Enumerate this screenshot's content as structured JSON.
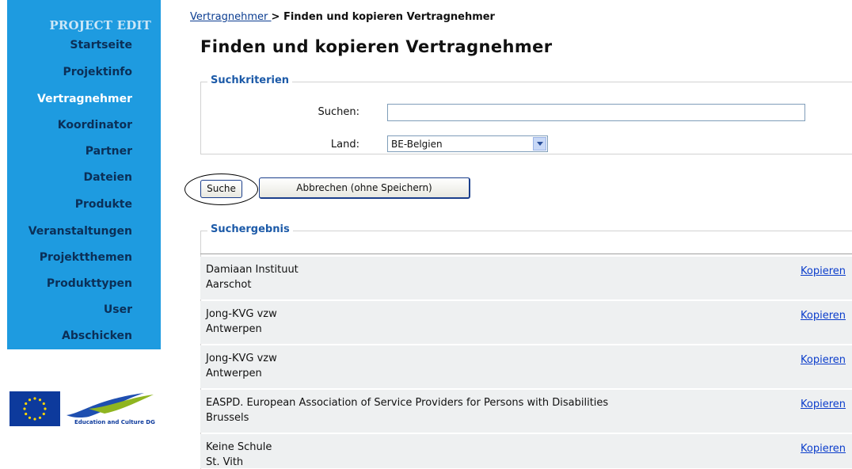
{
  "sidebar": {
    "title": "PROJECT EDIT",
    "items": [
      {
        "label": "Startseite"
      },
      {
        "label": "Projektinfo"
      },
      {
        "label": "Vertragnehmer"
      },
      {
        "label": "Koordinator"
      },
      {
        "label": "Partner"
      },
      {
        "label": "Dateien"
      },
      {
        "label": "Produkte"
      },
      {
        "label": "Veranstaltungen"
      },
      {
        "label": "Projektthemen"
      },
      {
        "label": "Produkttypen"
      },
      {
        "label": "User"
      },
      {
        "label": "Abschicken"
      }
    ],
    "active_item": "Vertragnehmer",
    "logo_text": "Education and Culture DG"
  },
  "breadcrumb": {
    "link": "Vertragnehmer ",
    "separator": " > ",
    "current": "Finden und kopieren Vertragnehmer"
  },
  "page": {
    "title": "Finden und kopieren Vertragnehmer"
  },
  "search": {
    "legend": "Suchkriterien",
    "search_label": "Suchen:",
    "search_value": "",
    "country_label": "Land:",
    "country_value": "BE-Belgien",
    "search_button": "Suche",
    "cancel_button": "Abbrechen (ohne Speichern)"
  },
  "results": {
    "legend": "Suchergebnis",
    "copy_label": "Kopieren",
    "rows": [
      {
        "name": "Damiaan Instituut",
        "city": "Aarschot"
      },
      {
        "name": "Jong-KVG vzw",
        "city": "Antwerpen"
      },
      {
        "name": "Jong-KVG vzw",
        "city": "Antwerpen"
      },
      {
        "name": "EASPD. European Association of Service Providers for Persons with Disabilities",
        "city": "Brussels"
      },
      {
        "name": "Keine Schule",
        "city": "St. Vith"
      }
    ]
  },
  "colors": {
    "sidebar_bg": "#1e9be0",
    "sidebar_text": "#0b2f57",
    "legend_text": "#1c5aa8",
    "link": "#0b3dcb"
  }
}
